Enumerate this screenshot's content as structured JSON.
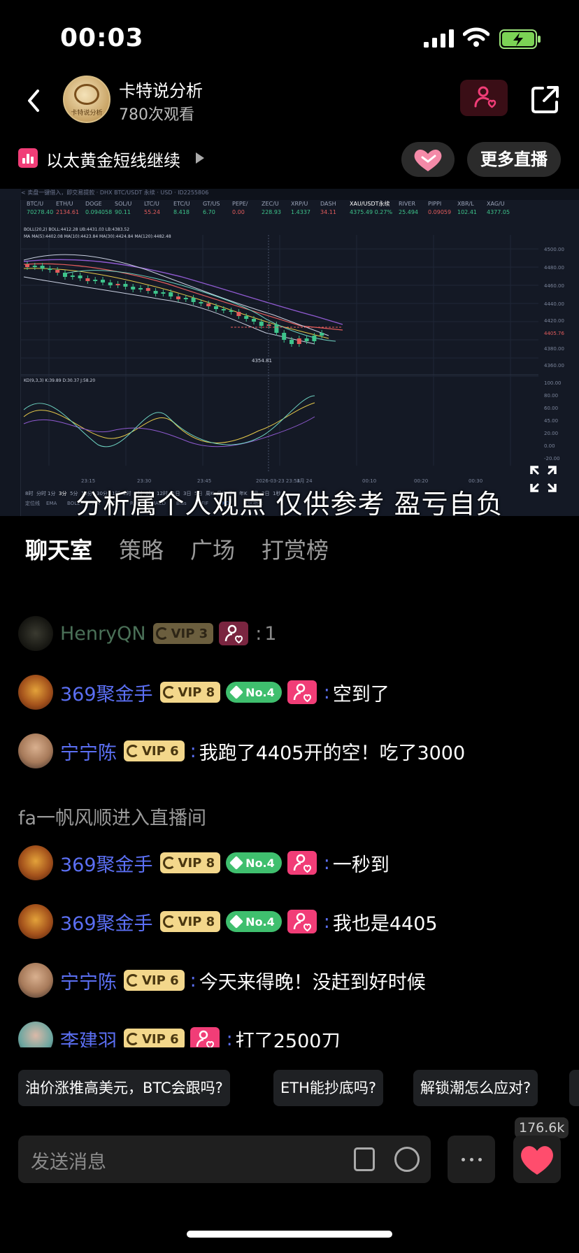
{
  "status": {
    "time": "00:03"
  },
  "header": {
    "name": "卡特说分析",
    "views": "780次观看",
    "avatar_text": "卡特说分析"
  },
  "topic": {
    "title": "以太黄金短线继续",
    "more_live": "更多直播"
  },
  "video": {
    "subtitle": "分析属个人观点 仅供参考 盈亏自负",
    "top_strip": "< 卖盘一键借入，即交易提款 · DHX BTC/USDT 永续 · USD · ID2255806",
    "tickers": [
      {
        "sym": "BTC/U",
        "val": "70278.40"
      },
      {
        "sym": "ETH/U",
        "val": "2134.61"
      },
      {
        "sym": "DOGE",
        "val": "0.094058"
      },
      {
        "sym": "SOL/U",
        "val": "90.11"
      },
      {
        "sym": "LTC/U",
        "val": "55.24"
      },
      {
        "sym": "ETC/U",
        "val": "8.418"
      },
      {
        "sym": "GT/US",
        "val": "6.70"
      },
      {
        "sym": "PEPE/",
        "val": "0.00"
      },
      {
        "sym": "ZEC/U",
        "val": "228.93"
      },
      {
        "sym": "XRP/U",
        "val": "1.4337"
      },
      {
        "sym": "DASH",
        "val": "34.11"
      },
      {
        "sym": "XAU/USDT永续",
        "val": "4375.49 0.27%"
      },
      {
        "sym": "RIVER",
        "val": "25.494"
      },
      {
        "sym": "PIPPI",
        "val": "0.09059"
      },
      {
        "sym": "XBR/L",
        "val": "102.41"
      },
      {
        "sym": "XAG/U",
        "val": "4377.05"
      }
    ],
    "indicators": {
      "boll": "BOLL(20,2) BOLL:4412.28 UB:4431.03 LB:4383.52",
      "ma": "MA MA(5):4402.08 MA(10):4423.84 MA(30):4424.84 MA(120):4482.48",
      "kdj": "KD(9,3,3) K:39.89 D:30.37 J:58.20"
    },
    "price_axis": [
      "4500.00",
      "4480.00",
      "4460.00",
      "4440.00",
      "4420.00",
      "4405.76",
      "4380.00",
      "4360.00"
    ],
    "osc_axis": [
      "100.00",
      "80.00",
      "60.00",
      "45.00",
      "20.00",
      "0.00",
      "-20.00"
    ],
    "time_axis": [
      "23:15",
      "23:30",
      "23:45",
      "2026-03-23 23:54",
      "3月 24",
      "00:10",
      "00:20",
      "00:30"
    ],
    "last_low": "4354.81",
    "periods": [
      "8时",
      "分时",
      "1分",
      "3分",
      "5分",
      "15分",
      "30分",
      "1时",
      "2时",
      "4时",
      "6时",
      "12时",
      "1日",
      "3日",
      "5日",
      "周K",
      "月K",
      "季K",
      "年K",
      "3月",
      "2日",
      "1秒"
    ],
    "bottom_ind": [
      "定位线",
      "EMA",
      "BOLL",
      "MA",
      "VOL",
      "RSI",
      "MACD",
      "Bias",
      "FIF",
      "KDJ",
      "社区指标"
    ]
  },
  "tabs": [
    "聊天室",
    "策略",
    "广场",
    "打赏榜"
  ],
  "chat": [
    {
      "type": "user",
      "avatar": "henry",
      "name": "HenryQN",
      "vip": "VIP 3",
      "rank": "",
      "text": "1",
      "dim": true
    },
    {
      "type": "user",
      "avatar": "dragon",
      "name": "369聚金手",
      "vip": "VIP 8",
      "rank": "No.4",
      "text": "空到了",
      "dim": false
    },
    {
      "type": "user",
      "avatar": "man",
      "name": "宁宁陈",
      "vip": "VIP 6",
      "rank": "",
      "text": "我跑了4405开的空！吃了3000",
      "dim": false
    },
    {
      "type": "system",
      "text": "fa一帆风顺进入直播间"
    },
    {
      "type": "user",
      "avatar": "dragon",
      "name": "369聚金手",
      "vip": "VIP 8",
      "rank": "No.4",
      "text": "一秒到",
      "dim": false
    },
    {
      "type": "user",
      "avatar": "dragon",
      "name": "369聚金手",
      "vip": "VIP 8",
      "rank": "No.4",
      "text": "我也是4405",
      "dim": false
    },
    {
      "type": "user",
      "avatar": "man",
      "name": "宁宁陈",
      "vip": "VIP 6",
      "rank": "",
      "text": "今天来得晚！没赶到好时候",
      "dim": false
    },
    {
      "type": "user",
      "avatar": "girl",
      "name": "李建羽",
      "vip": "VIP 6",
      "rank": "",
      "text": "打了2500刀",
      "dim": false
    }
  ],
  "quick_questions": [
    "油价涨推高美元，BTC会跟吗?",
    "ETH能抄底吗?",
    "解锁潮怎么应对?"
  ],
  "input": {
    "placeholder": "发送消息"
  },
  "likes": "176.6k",
  "colors": {
    "accent": "#f13d77",
    "username": "#5b6ff3",
    "vip": "#f3d78b",
    "rank": "#3fbf6e"
  }
}
